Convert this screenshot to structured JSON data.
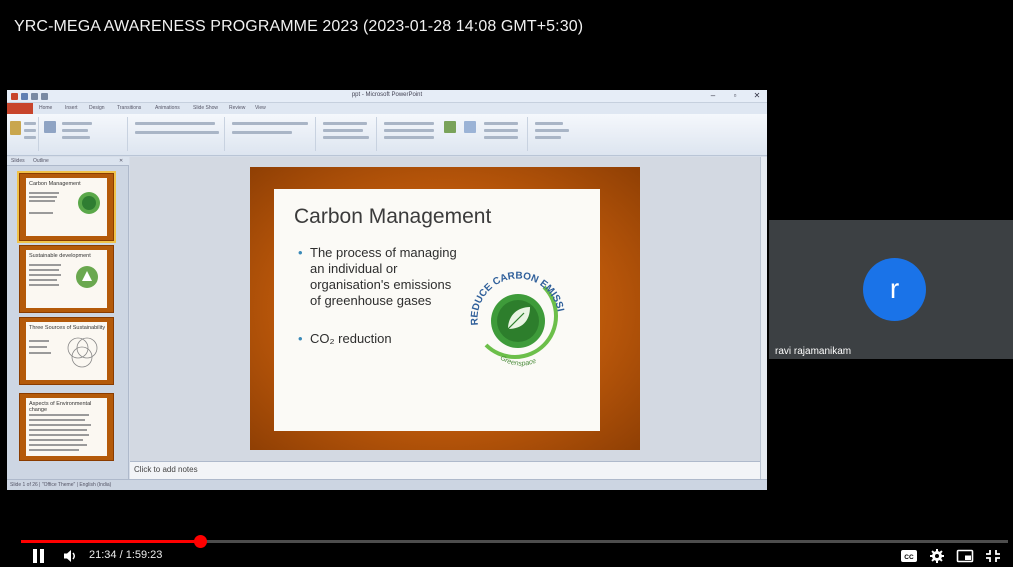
{
  "video": {
    "title": "YRC-MEGA AWARENESS PROGRAMME 2023 (2023-01-28 14:08 GMT+5:30)",
    "current_time": "21:34",
    "duration": "1:59:23",
    "time_display": "21:34 / 1:59:23",
    "progress": 0.181,
    "progress_color": "#ff0000",
    "controls": [
      "pause-icon",
      "volume-icon",
      "subtitles-icon",
      "settings-icon",
      "miniplayer-icon",
      "fullscreen-exit-icon"
    ]
  },
  "slide": {
    "title": "Carbon Management",
    "bullets": [
      "The process of managing an individual or organisation's emissions of greenhouse gases",
      "CO₂ reduction"
    ],
    "logo_text": "REDUCE CARBON EMISSIONS",
    "logo_subtext": "Greenspace",
    "background_color": "#b8560a"
  },
  "powerpoint": {
    "notes_placeholder": "Click to add notes"
  },
  "participant": {
    "initial": "r",
    "name": "ravi rajamanikam",
    "avatar_color": "#1a73e8"
  }
}
